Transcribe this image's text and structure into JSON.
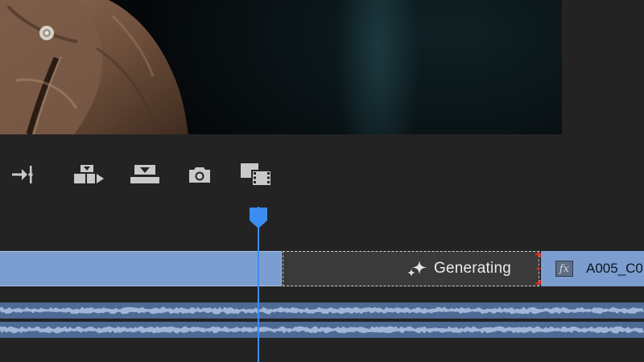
{
  "colors": {
    "accent": "#3b8df0",
    "clip_video": "#7b9dd0",
    "audio_track": "#4c6a93",
    "generating_bg": "#3a3a3a",
    "panel_bg": "#232323",
    "trim_handle": "#e0241b"
  },
  "monitor": {
    "content": "leather-jacket-frame"
  },
  "transport": {
    "buttons": [
      {
        "name": "go-to-out-point-icon"
      },
      {
        "name": "insert-icon"
      },
      {
        "name": "overwrite-icon"
      },
      {
        "name": "export-frame-icon"
      },
      {
        "name": "comparison-view-icon"
      }
    ]
  },
  "timeline": {
    "generating_clip": {
      "label": "Generating",
      "icon": "sparkles-icon"
    },
    "next_clip": {
      "name": "A005_C0",
      "fx_label": "fx"
    }
  }
}
